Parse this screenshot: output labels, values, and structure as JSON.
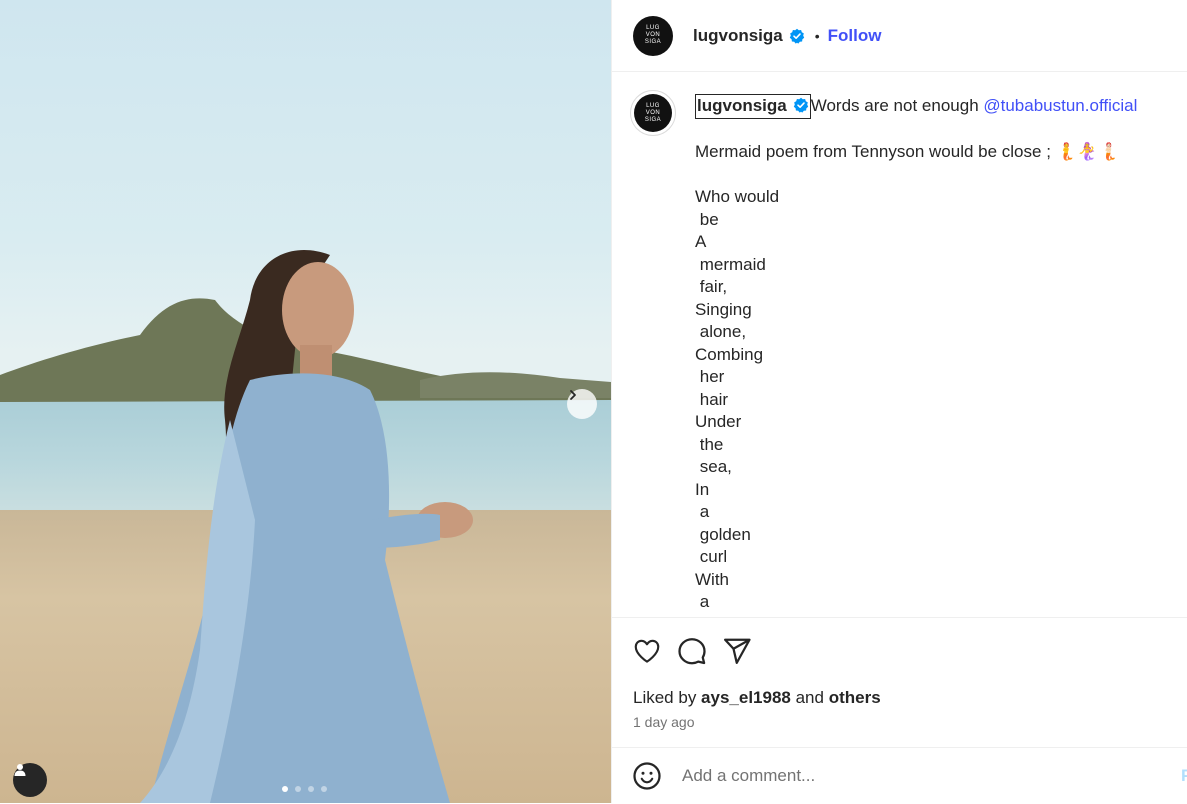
{
  "media": {
    "carousel_dots": 4,
    "active_dot": 0,
    "next_icon": "chevron-right-icon",
    "user_tag_icon": "person-icon"
  },
  "header": {
    "username": "lugvonsiga",
    "verified_icon": "verified-badge-icon",
    "separator": "•",
    "follow_label": "Follow",
    "avatar_text": [
      "LUG",
      "VON",
      "SIGA"
    ]
  },
  "caption": {
    "username": "lugvonsiga",
    "text": "Words are not enough ",
    "mention": "@tubabustun.official",
    "body": "\n\nMermaid poem from Tennyson would be close ; 🧜🧜‍♀️🧜🏻\n\nWho would\n be\nA\n mermaid\n fair,\nSinging\n alone,\nCombing\n her\n hair\nUnder\n the\n sea,\nIn\n a\n golden\n curl\nWith\n a\n comb"
  },
  "actions": {
    "like_icon": "heart-icon",
    "comment_icon": "comment-icon",
    "share_icon": "send-icon",
    "liked_by_prefix": "Liked by ",
    "liked_by_user": "ays_el1988",
    "liked_by_and": " and ",
    "liked_by_others": "others",
    "time_ago": "1 day ago"
  },
  "comment_box": {
    "emoji_icon": "emoji-icon",
    "placeholder": "Add a comment...",
    "post_label": "P"
  },
  "colors": {
    "link": "#4150f7",
    "verified": "#0095f6",
    "text": "#262626",
    "muted": "#737373"
  }
}
